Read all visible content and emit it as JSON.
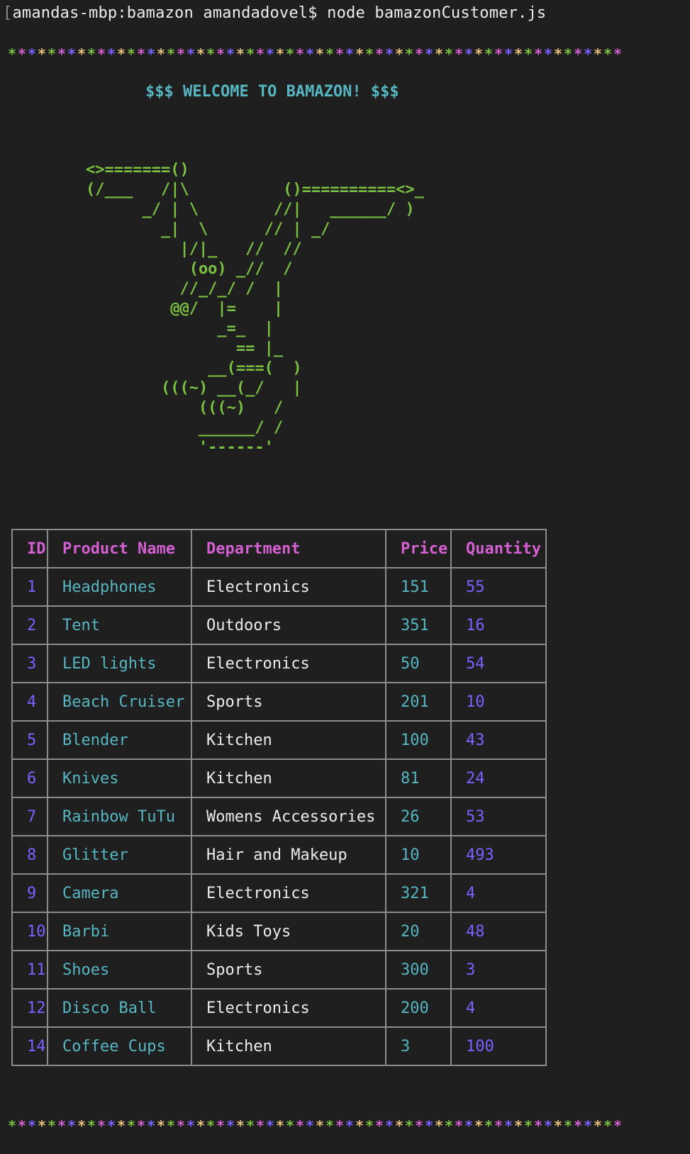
{
  "terminal": {
    "prompt": "amandas-mbp:bamazon amandadovel$ node bamazonCustomer.js"
  },
  "banner": {
    "stars": "**************************************************************",
    "star_colors": [
      "#7ac142",
      "#d45fd1",
      "#7b61ff",
      "#e5c07b"
    ],
    "welcome": "$$$ WELCOME TO BAMAZON! $$$",
    "ascii_art": [
      "<>=======()",
      "(/___   /|\\          ()==========<>_",
      "      _/ | \\        //|   ______/ )",
      "        _|  \\      // | _/",
      "          |/|_   //  //",
      "           (oo) _//  /",
      "          //_/_/ /  |",
      "         @@/  |=    |",
      "              _=_  |",
      "                == |_",
      "             __(===(  )",
      "        (((~) __(_/   |",
      "            (((~)   /",
      "            ______/ /",
      "            '------'"
    ]
  },
  "table": {
    "headers": [
      "ID",
      "Product Name",
      "Department",
      "Price",
      "Quantity"
    ],
    "rows": [
      {
        "id": "1",
        "name": "Headphones",
        "dept": "Electronics",
        "price": "151",
        "qty": "55"
      },
      {
        "id": "2",
        "name": "Tent",
        "dept": "Outdoors",
        "price": "351",
        "qty": "16"
      },
      {
        "id": "3",
        "name": "LED lights",
        "dept": "Electronics",
        "price": "50",
        "qty": "54"
      },
      {
        "id": "4",
        "name": "Beach Cruiser",
        "dept": "Sports",
        "price": "201",
        "qty": "10"
      },
      {
        "id": "5",
        "name": "Blender",
        "dept": "Kitchen",
        "price": "100",
        "qty": "43"
      },
      {
        "id": "6",
        "name": "Knives",
        "dept": "Kitchen",
        "price": "81",
        "qty": "24"
      },
      {
        "id": "7",
        "name": "Rainbow TuTu",
        "dept": "Womens Accessories",
        "price": "26",
        "qty": "53"
      },
      {
        "id": "8",
        "name": "Glitter",
        "dept": "Hair and Makeup",
        "price": "10",
        "qty": "493"
      },
      {
        "id": "9",
        "name": "Camera",
        "dept": "Electronics",
        "price": "321",
        "qty": "4"
      },
      {
        "id": "10",
        "name": "Barbi",
        "dept": "Kids Toys",
        "price": "20",
        "qty": "48"
      },
      {
        "id": "11",
        "name": "Shoes",
        "dept": "Sports",
        "price": "300",
        "qty": "3"
      },
      {
        "id": "12",
        "name": "Disco Ball",
        "dept": "Electronics",
        "price": "200",
        "qty": "4"
      },
      {
        "id": "14",
        "name": "Coffee Cups",
        "dept": "Kitchen",
        "price": "3",
        "qty": "100"
      }
    ]
  }
}
